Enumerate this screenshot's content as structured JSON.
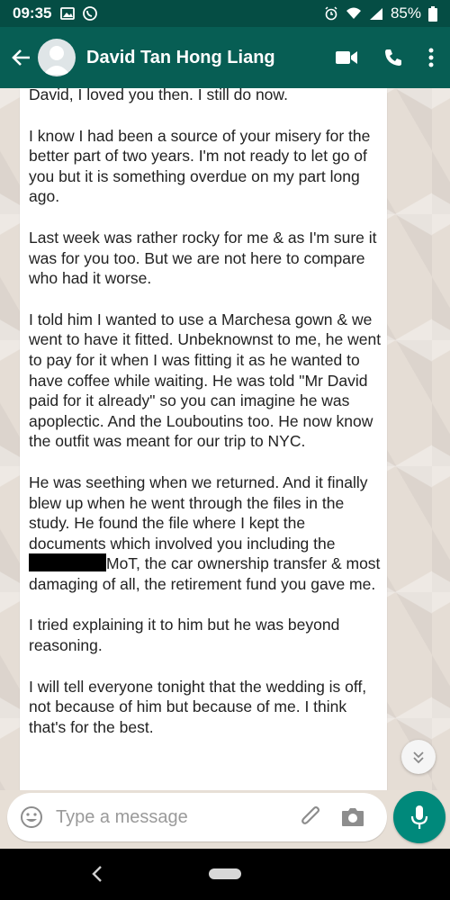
{
  "status_bar": {
    "time": "09:35",
    "battery": "85%",
    "icons": [
      "image-icon",
      "whatsapp-icon",
      "alarm-icon",
      "wifi-icon",
      "signal-icon",
      "battery-icon"
    ]
  },
  "header": {
    "contact_name": "David Tan Hong Liang",
    "icons": [
      "back-arrow-icon",
      "avatar",
      "video-call-icon",
      "phone-icon",
      "more-icon"
    ],
    "colors": {
      "bar": "#075e54",
      "status": "#054d44"
    }
  },
  "message": {
    "paragraphs": [
      "David, I loved you then. I still do now.",
      "I know I had been a source of your misery for the better part of two years. I'm not ready to let go of you but it is something overdue on my part long ago.",
      "Last week was rather rocky for me & as I'm sure it was for you too. But we are not here to compare who had it worse.",
      "I told him I wanted to use a Marchesa gown & we went to have it fitted. Unbeknownst to me, he went to pay for it when I was fitting it as he wanted to have coffee while waiting. He was told \"Mr David paid for it already\" so you can imagine he was apoplectic. And the Louboutins too. He now know the outfit was meant for our trip to NYC.",
      "I tried explaining it to him but he was beyond reasoning.",
      "I will tell everyone tonight that the wedding is off, not because of him but because of me. I think that's for the best."
    ],
    "paragraph5_before_redaction": "He was seething when we returned. And it finally blew up when he went through the files in the study. He found the file where I kept the documents which involved you including the",
    "paragraph5_after_redaction": "MoT, the car ownership transfer & most damaging of all, the retirement fund you gave me."
  },
  "composer": {
    "placeholder": "Type a message",
    "icons": [
      "emoji-icon",
      "attach-icon",
      "camera-icon",
      "mic-icon"
    ],
    "mic_color": "#00897b"
  },
  "scroll_button": {
    "icon": "double-chevron-down-icon"
  },
  "nav": {
    "icons": [
      "nav-back-icon",
      "nav-home-pill"
    ]
  }
}
